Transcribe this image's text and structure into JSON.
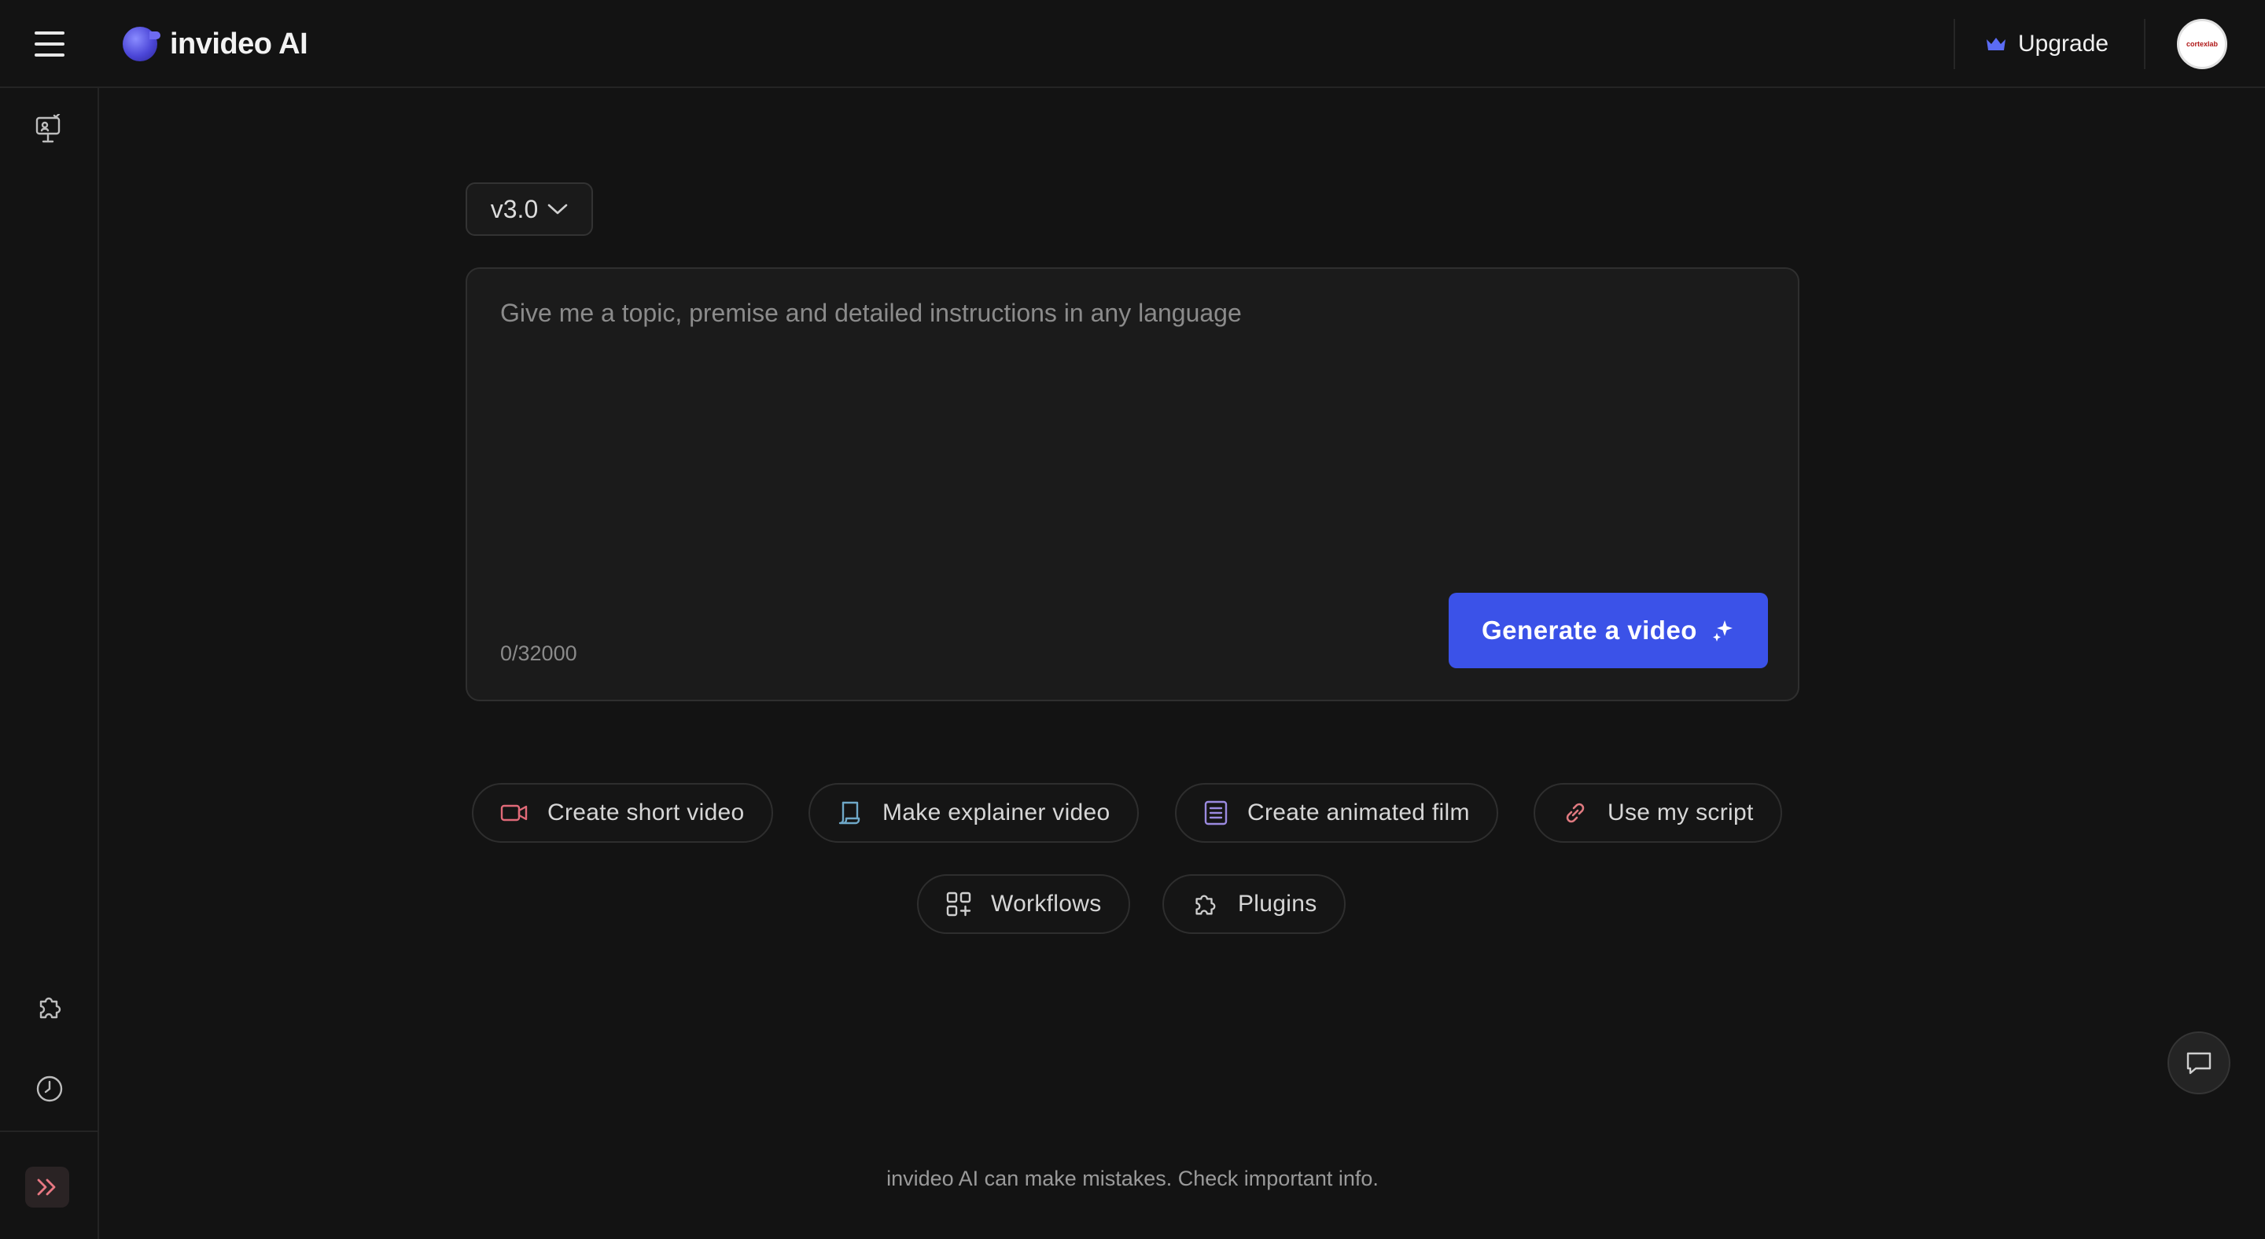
{
  "header": {
    "brand": "invideo AI",
    "upgrade_label": "Upgrade",
    "avatar_text": "cortexlab"
  },
  "sidebar": {
    "icons": [
      "presentation-icon",
      "puzzle-icon",
      "clock-icon"
    ],
    "expand_icon": "double-chevron-right-icon"
  },
  "main": {
    "version_label": "v3.0",
    "prompt_placeholder": "Give me a topic, premise and detailed instructions in any language",
    "prompt_value": "",
    "char_counter": "0/32000",
    "generate_label": "Generate a video",
    "chips": [
      {
        "label": "Create short video",
        "icon": "video-camera-icon",
        "color": "#e06a78"
      },
      {
        "label": "Make explainer video",
        "icon": "scroll-icon",
        "color": "#6fa8c8"
      },
      {
        "label": "Create animated film",
        "icon": "document-list-icon",
        "color": "#9b8ae0"
      },
      {
        "label": "Use my script",
        "icon": "link-icon",
        "color": "#e07a80"
      },
      {
        "label": "Workflows",
        "icon": "grid-plus-icon",
        "color": "#cfcfcf"
      },
      {
        "label": "Plugins",
        "icon": "puzzle-icon",
        "color": "#cfcfcf"
      }
    ]
  },
  "footer": {
    "disclaimer": "invideo AI can make mistakes. Check important info."
  },
  "colors": {
    "accent": "#3b52e8",
    "background": "#131313",
    "upgrade_crown": "#5b6cf5"
  }
}
